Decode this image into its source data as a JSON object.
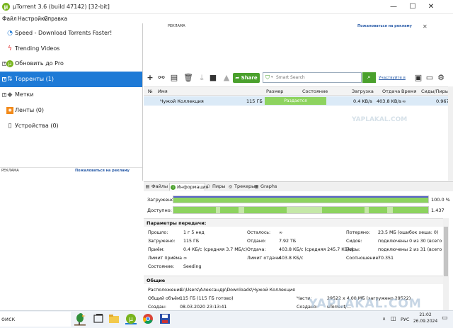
{
  "window": {
    "title": "µTorrent 3.6  (build 47142) [32-bit]",
    "minimize": "—",
    "maximize": "☐",
    "close": "✕"
  },
  "menu": [
    "Файл",
    "Настройки",
    "Справка"
  ],
  "sidebar": {
    "items": [
      {
        "label": "Speed - Download Torrents Faster!",
        "icon": "speed-icon"
      },
      {
        "label": "Trending Videos",
        "icon": "lightning-icon"
      },
      {
        "label": "Обновить до Pro",
        "icon": "utorrent-icon"
      },
      {
        "label": "Торренты (1)",
        "icon": "torrents-icon"
      },
      {
        "label": "Метки",
        "icon": "labels-icon"
      },
      {
        "label": "Ленты (0)",
        "icon": "rss-icon"
      },
      {
        "label": "Устройства (0)",
        "icon": "device-icon"
      }
    ],
    "ad": {
      "label": "РЕКЛАМА",
      "link": "Пожаловаться на рекламу"
    }
  },
  "top_ad": {
    "label": "РЕКЛАМА",
    "link": "Пожаловаться на рекламу",
    "close": "✕"
  },
  "toolbar": {
    "share": "Share",
    "search_placeholder": "Smart Search",
    "smart_link": "Участвуйте в"
  },
  "torrent_table": {
    "headers": [
      "№",
      "Имя",
      "Размер",
      "Состояние",
      "Загрузка",
      "Отдача",
      "Время",
      "Сиды/Пиры"
    ],
    "rows": [
      {
        "num": "",
        "name": "Чужой Коллекция",
        "size": "115 ГБ",
        "status": "Раздается",
        "download": "0.4 KB/s",
        "upload": "403.8 KB/s",
        "eta": "∞",
        "ratio": "0.967"
      }
    ]
  },
  "detail_tabs": [
    "Файлы",
    "Информация",
    "Пиры",
    "Трекеры",
    "Graphs"
  ],
  "info": {
    "downloaded_label": "Загружено:",
    "downloaded_pct": "100.0 %",
    "downloaded_fill": 1.0,
    "available_label": "Доступно:",
    "available_value": "1.437",
    "transfer_head": "Параметры передачи:",
    "col1": [
      [
        "Прошло:",
        "1 г 5 нед"
      ],
      [
        "Загружено:",
        "115 ГБ"
      ],
      [
        "Приём:",
        "0.4 КБ/с (средняя 3.7 МБ/с)"
      ],
      [
        "Лимит приёма",
        "∞"
      ],
      [
        "Состояние:",
        "Seeding"
      ]
    ],
    "col2": [
      [
        "Осталось:",
        "∞"
      ],
      [
        "Отдано:",
        "7.92 ТБ"
      ],
      [
        "Отдача:",
        "403.8 КБ/с (средняя 245.7 КБ/с)"
      ],
      [
        "Лимит отдачи",
        "403.8 КБ/с"
      ]
    ],
    "col3": [
      [
        "Потеряно:",
        "23.5 МБ (ошибок хеша: 0)"
      ],
      [
        "Сидов:",
        "подключены 0 из 30 (всего 0)"
      ],
      [
        "Пиры:",
        "подключены 2 из 31 (всего 0)"
      ],
      [
        "Соотношение:",
        "70.351"
      ]
    ],
    "general_head": "Общие",
    "location_label": "Расположение:",
    "location": "C:\\Users\\Александр\\Downloads\\Чужой Коллекция",
    "total_label": "Общий объём:",
    "total": "115 ГБ (115 ГБ готово)",
    "created_label": "Создан:",
    "created": "08.03.2020 23:13:41",
    "pieces_label": "Части:",
    "pieces": "29522 x 4.00 МБ (загружено 29522)",
    "created_by_label": "Создано:",
    "created_by": "uTorrent/..."
  },
  "taskbar": {
    "search": "оиск",
    "lang": "РУС",
    "time": "21:02",
    "date": "26.09.2024"
  },
  "watermark": "YAPLAKAL.COM",
  "watermark_small": "YAPLAKAL.COM"
}
